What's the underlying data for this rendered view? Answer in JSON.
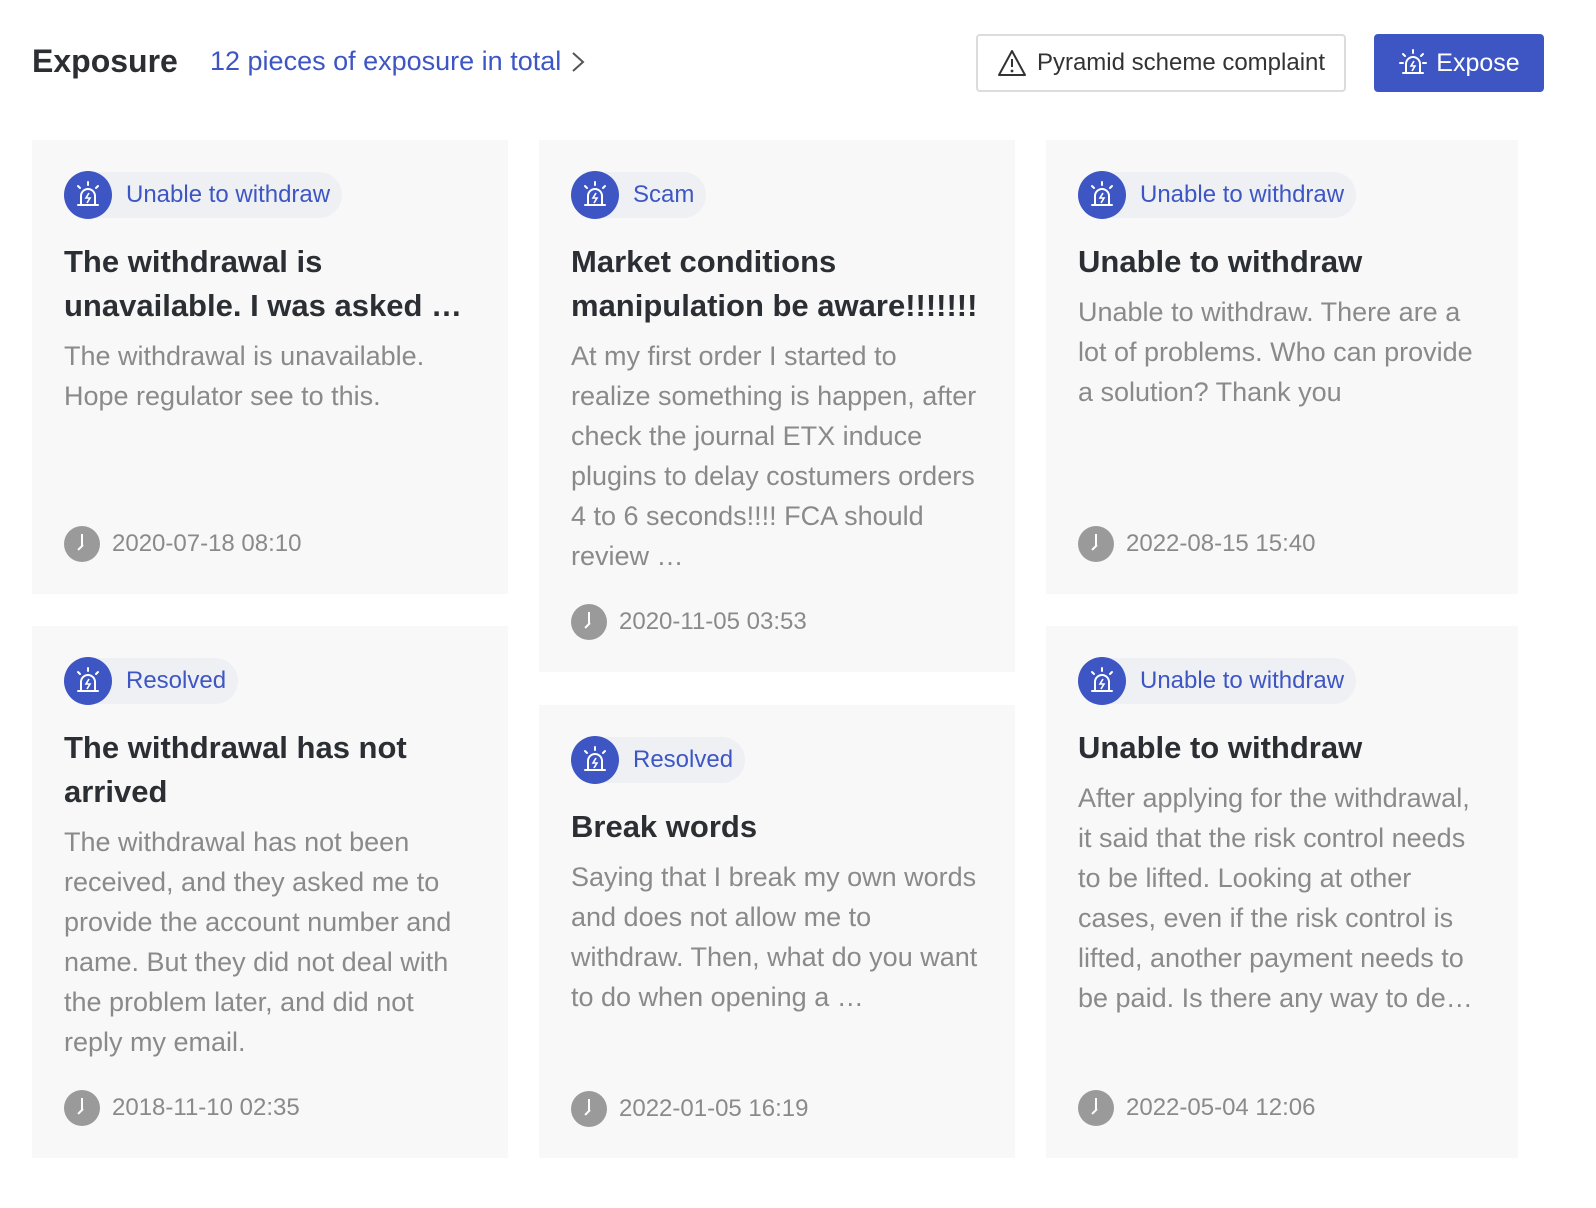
{
  "header": {
    "title": "Exposure",
    "total_link": "12 pieces of exposure in total",
    "complaint_button": "Pyramid scheme complaint",
    "expose_button": "Expose"
  },
  "colors": {
    "accent": "#3e56c4",
    "card_bg": "#f8f8f8",
    "tag_bg": "#eef0f4",
    "body_text": "#8a8a8a"
  },
  "icons": {
    "tag_icon": "alarm-siren-icon",
    "time_icon": "clock-icon",
    "complaint_icon": "warning-triangle-icon",
    "expose_icon": "alarm-siren-icon",
    "link_icon": "chevron-right-icon"
  },
  "cards": [
    {
      "tag": "Unable to withdraw",
      "title": "The withdrawal is unavailable. I was asked …",
      "body": "The withdrawal is unavailable. Hope regulator see to this.",
      "time": "2020-07-18 08:10"
    },
    {
      "tag": "Scam",
      "title": "Market conditions manipulation be aware!!!!!!!",
      "body": "At my first order I started to realize something is happen, after check the journal ETX induce plugins to delay costumers orders 4 to 6 seconds!!!! FCA should review …",
      "time": "2020-11-05 03:53"
    },
    {
      "tag": "Unable to withdraw",
      "title": "Unable to withdraw",
      "body": "Unable to withdraw. There are a lot of problems. Who can provide a solution? Thank you",
      "time": "2022-08-15 15:40"
    },
    {
      "tag": "Resolved",
      "title": "The withdrawal has not arrived",
      "body": "The withdrawal has not been received, and they asked me to provide the account number and name. But they did not deal with the problem later, and did not reply my email.",
      "time": "2018-11-10 02:35"
    },
    {
      "tag": "Resolved",
      "title": "Break words",
      "body": "Saying that I break my own words and does not allow me to withdraw. Then, what do you want to do when opening a …",
      "time": "2022-01-05 16:19"
    },
    {
      "tag": "Unable to withdraw",
      "title": "Unable to withdraw",
      "body": "After applying for the withdrawal, it said that the risk control needs to be lifted. Looking at other cases, even if the risk control is lifted, another payment needs to be paid. Is there any way to de…",
      "time": "2022-05-04 12:06"
    }
  ]
}
